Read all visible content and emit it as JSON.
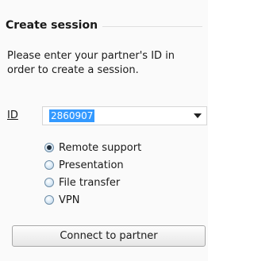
{
  "session": {
    "title": "Create session",
    "instructions": "Please enter your partner's ID in order to create a session.",
    "id_label": "ID",
    "id_value": "2860907",
    "modes": [
      {
        "label": "Remote support",
        "checked": true
      },
      {
        "label": "Presentation",
        "checked": false
      },
      {
        "label": "File transfer",
        "checked": false
      },
      {
        "label": "VPN",
        "checked": false
      }
    ],
    "connect_label": "Connect to partner"
  },
  "colors": {
    "selection": "#3399ff",
    "panel_background": "#fafafa"
  },
  "icons": {
    "dropdown": "chevron-down-icon"
  }
}
